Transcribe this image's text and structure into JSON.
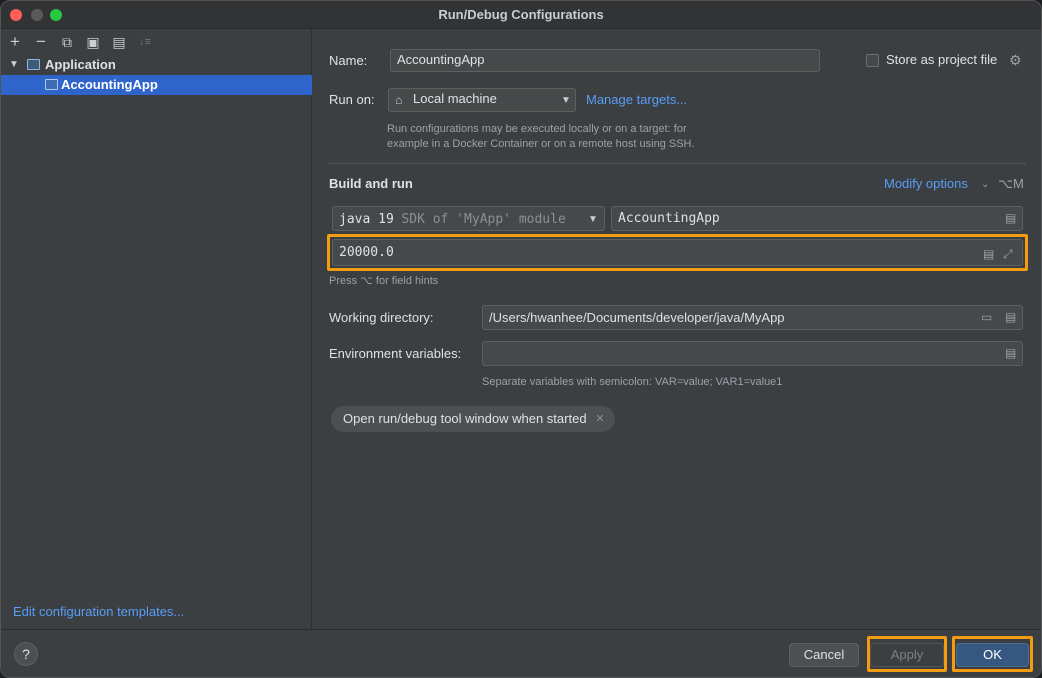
{
  "window": {
    "title": "Run/Debug Configurations"
  },
  "toolbar": {
    "add": "+",
    "remove": "−",
    "copy": "⧉",
    "save": "▣",
    "folder": "▤",
    "sort": "↓≡"
  },
  "tree": {
    "group": "Application",
    "item": "AccountingApp"
  },
  "left_footer": {
    "edit_templates": "Edit configuration templates..."
  },
  "form": {
    "name_label": "Name:",
    "name_value": "AccountingApp",
    "store_label": "Store as project file",
    "run_on_label": "Run on:",
    "run_on_value": "Local machine",
    "manage_targets": "Manage targets...",
    "run_on_hint_1": "Run configurations may be executed locally or on a target: for",
    "run_on_hint_2": "example in a Docker Container or on a remote host using SSH.",
    "build_run_label": "Build and run",
    "modify_options": "Modify options",
    "modify_shortcut": "⌥M",
    "jdk_main": "java 19",
    "jdk_detail": "SDK of 'MyApp' module",
    "main_class": "AccountingApp",
    "program_args": "20000.0",
    "field_hint": "Press ⌥ for field hints",
    "workdir_label": "Working directory:",
    "workdir_value": "/Users/hwanhee/Documents/developer/java/MyApp",
    "env_label": "Environment variables:",
    "env_value": "",
    "env_hint": "Separate variables with semicolon: VAR=value; VAR1=value1",
    "chip_label": "Open run/debug tool window when started"
  },
  "footer": {
    "help": "?",
    "cancel": "Cancel",
    "apply": "Apply",
    "ok": "OK"
  },
  "colors": {
    "accent": "#589df6",
    "selection": "#2f65ca",
    "highlight": "#f39c12",
    "ok_button": "#365880"
  }
}
